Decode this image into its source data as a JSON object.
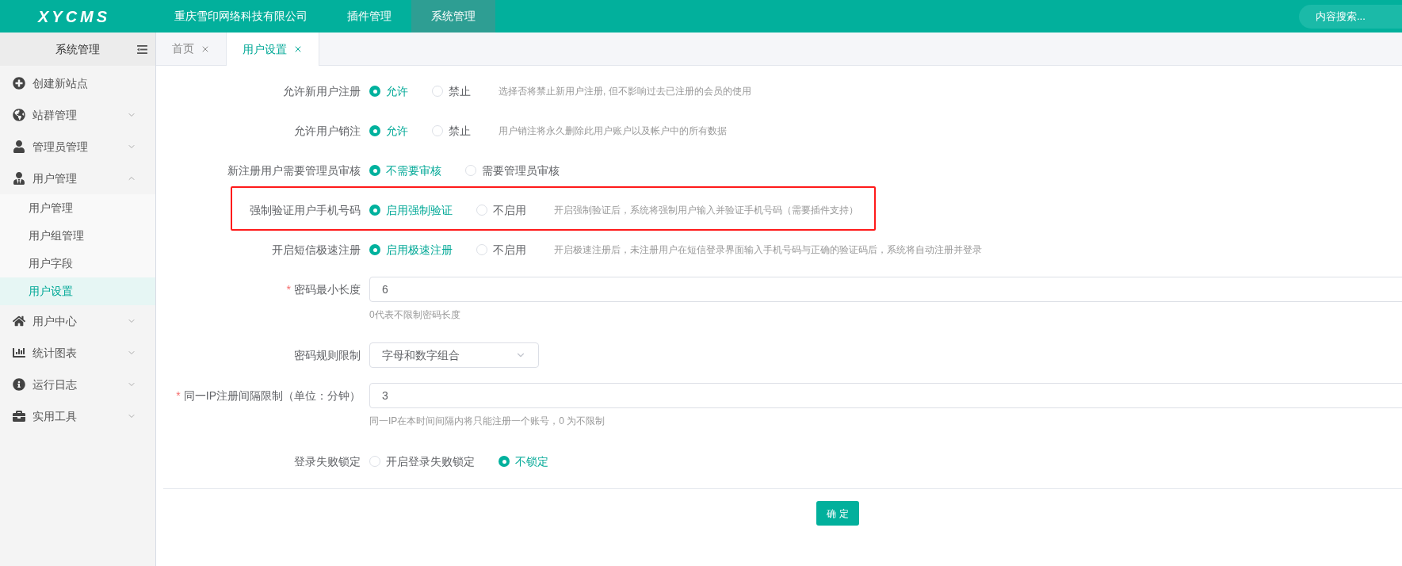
{
  "header": {
    "logo": "XYCMS",
    "nav": [
      {
        "label": "重庆雪印网络科技有限公司",
        "selected": false
      },
      {
        "label": "插件管理",
        "selected": false
      },
      {
        "label": "系统管理",
        "selected": true
      }
    ],
    "search": {
      "placeholder": "内容搜索..."
    }
  },
  "sidebar": {
    "title": "系统管理",
    "items": [
      {
        "label": "创建新站点"
      },
      {
        "label": "站群管理",
        "expanded": false
      },
      {
        "label": "管理员管理",
        "expanded": false
      },
      {
        "label": "用户管理",
        "expanded": true,
        "children": [
          {
            "label": "用户管理",
            "selected": false
          },
          {
            "label": "用户组管理",
            "selected": false
          },
          {
            "label": "用户字段",
            "selected": false
          },
          {
            "label": "用户设置",
            "selected": true
          }
        ]
      },
      {
        "label": "用户中心",
        "expanded": false
      },
      {
        "label": "统计图表",
        "expanded": false
      },
      {
        "label": "运行日志",
        "expanded": false
      },
      {
        "label": "实用工具",
        "expanded": false
      }
    ]
  },
  "tabs": [
    {
      "label": "首页",
      "selected": false
    },
    {
      "label": "用户设置",
      "selected": true
    }
  ],
  "form": {
    "rows": [
      {
        "kind": "radio",
        "label": "允许新用户注册",
        "highlighted": false,
        "options": [
          {
            "label": "允许",
            "selected": true
          },
          {
            "label": "禁止",
            "selected": false
          }
        ],
        "help": "选择否将禁止新用户注册, 但不影响过去已注册的会员的使用"
      },
      {
        "kind": "radio",
        "label": "允许用户销注",
        "highlighted": false,
        "options": [
          {
            "label": "允许",
            "selected": true
          },
          {
            "label": "禁止",
            "selected": false
          }
        ],
        "help": "用户销注将永久删除此用户账户以及帐户中的所有数据"
      },
      {
        "kind": "radio",
        "label": "新注册用户需要管理员审核",
        "highlighted": false,
        "options": [
          {
            "label": "不需要审核",
            "selected": true
          },
          {
            "label": "需要管理员审核",
            "selected": false
          }
        ]
      },
      {
        "kind": "radio",
        "label": "强制验证用户手机号码",
        "highlighted": true,
        "options": [
          {
            "label": "启用强制验证",
            "selected": true
          },
          {
            "label": "不启用",
            "selected": false
          }
        ],
        "help": "开启强制验证后，系统将强制用户输入并验证手机号码（需要插件支持）"
      },
      {
        "kind": "radio",
        "label": "开启短信极速注册",
        "highlighted": false,
        "options": [
          {
            "label": "启用极速注册",
            "selected": true
          },
          {
            "label": "不启用",
            "selected": false
          }
        ],
        "help": "开启极速注册后，未注册用户在短信登录界面输入手机号码与正确的验证码后，系统将自动注册并登录"
      },
      {
        "kind": "input",
        "label": "密码最小长度",
        "required_mark": "*",
        "value": "6",
        "help": "0代表不限制密码长度"
      },
      {
        "kind": "select",
        "label": "密码规则限制",
        "value": "字母和数字组合"
      },
      {
        "kind": "input",
        "label": "同一IP注册间隔限制（单位：分钟）",
        "required_mark": "*",
        "value": "3",
        "help": "同一IP在本时间间隔内将只能注册一个账号，0 为不限制"
      },
      {
        "kind": "radio",
        "label": "登录失败锁定",
        "highlighted": false,
        "options": [
          {
            "label": "开启登录失败锁定",
            "selected": false
          },
          {
            "label": "不锁定",
            "selected": true
          }
        ]
      }
    ],
    "submit": "确 定"
  }
}
